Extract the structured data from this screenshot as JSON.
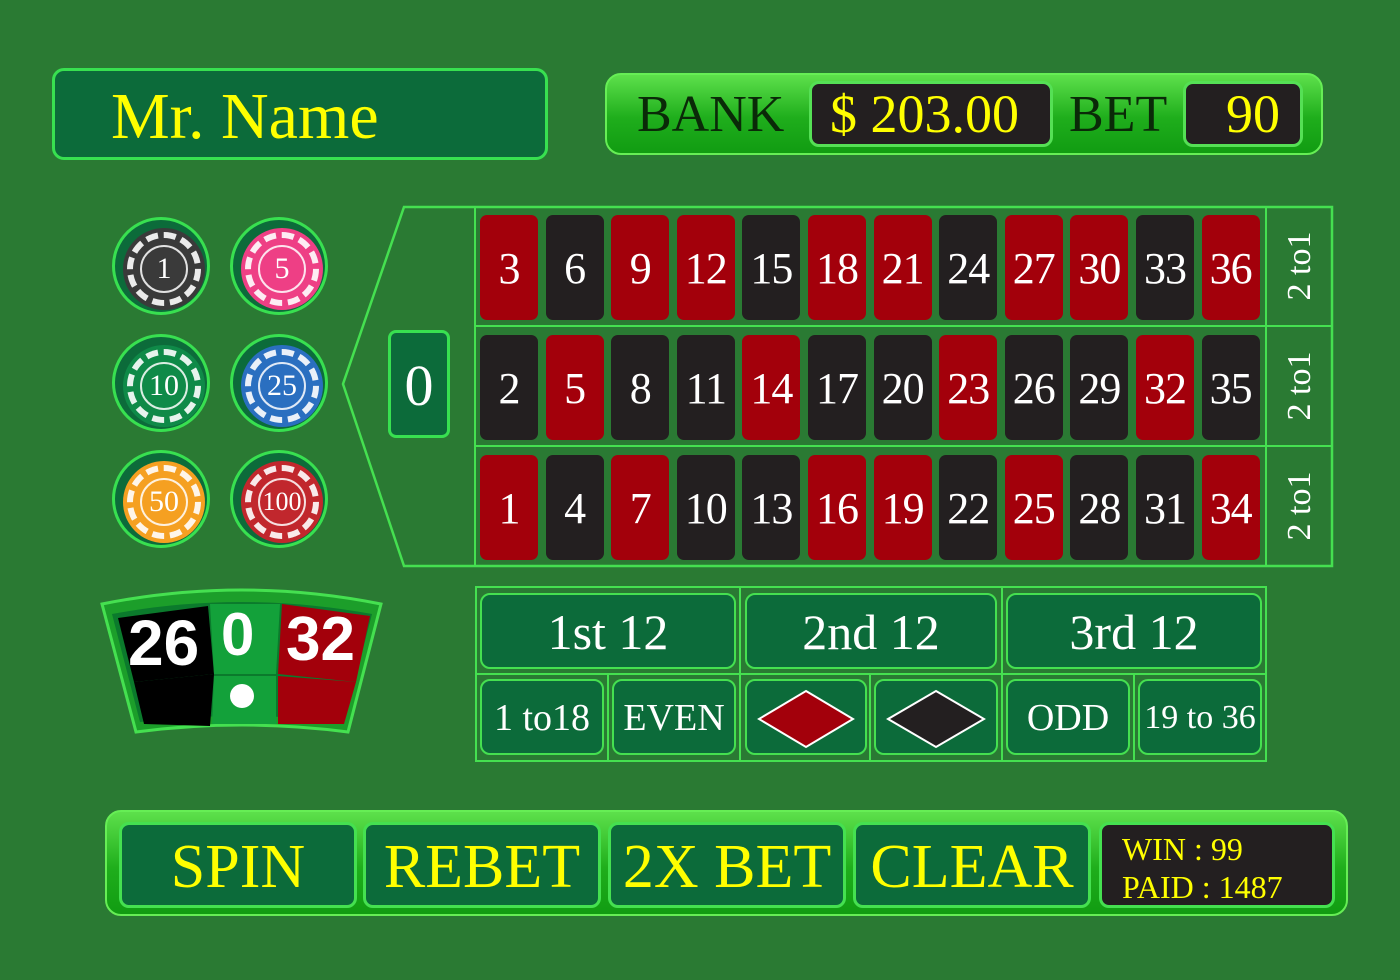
{
  "player": {
    "name": "Mr. Name"
  },
  "bank": {
    "label": "BANK",
    "value": "$ 203.00",
    "bet_label": "BET",
    "bet_value": "90"
  },
  "chips": [
    {
      "label": "1",
      "color": "#3a3a3a"
    },
    {
      "label": "5",
      "color": "#ee3f85"
    },
    {
      "label": "10",
      "color": "#0f8a48"
    },
    {
      "label": "25",
      "color": "#2a6fc0"
    },
    {
      "label": "50",
      "color": "#f5a021"
    },
    {
      "label": "100",
      "color": "#c1272d"
    }
  ],
  "history": {
    "left": "26",
    "center": "0",
    "right": "32"
  },
  "table": {
    "zero": "0",
    "rows": [
      {
        "numbers": [
          "3",
          "6",
          "9",
          "12",
          "15",
          "18",
          "21",
          "24",
          "27",
          "30",
          "33",
          "36"
        ],
        "colors": [
          "red",
          "black",
          "red",
          "red",
          "black",
          "red",
          "red",
          "black",
          "red",
          "red",
          "black",
          "red"
        ],
        "column_bet": "2 to1"
      },
      {
        "numbers": [
          "2",
          "5",
          "8",
          "11",
          "14",
          "17",
          "20",
          "23",
          "26",
          "29",
          "32",
          "35"
        ],
        "colors": [
          "black",
          "red",
          "black",
          "black",
          "red",
          "black",
          "black",
          "red",
          "black",
          "black",
          "red",
          "black"
        ],
        "column_bet": "2 to1"
      },
      {
        "numbers": [
          "1",
          "4",
          "7",
          "10",
          "13",
          "16",
          "19",
          "22",
          "25",
          "28",
          "31",
          "34"
        ],
        "colors": [
          "red",
          "black",
          "red",
          "black",
          "black",
          "red",
          "red",
          "black",
          "red",
          "black",
          "black",
          "red"
        ],
        "column_bet": "2 to1"
      }
    ],
    "dozens": [
      "1st 12",
      "2nd 12",
      "3rd 12"
    ],
    "outside": {
      "low": "1 to18",
      "even": "EVEN",
      "red": "red-diamond",
      "black": "black-diamond",
      "odd": "ODD",
      "high": "19 to 36"
    }
  },
  "buttons": {
    "spin": "SPIN",
    "rebet": "REBET",
    "double": "2X BET",
    "clear": "CLEAR"
  },
  "stats": {
    "win": "WIN : 99",
    "paid": "PAID : 1487"
  },
  "colors": {
    "felt": "#2a7a33",
    "red": "#a3000b",
    "black": "#231f20",
    "accent": "#ffff00",
    "border": "#38e050"
  }
}
